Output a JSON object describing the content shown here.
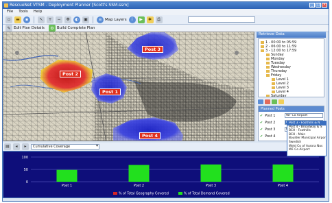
{
  "window": {
    "title": "RescueNet VTSM - Deployment Planner [Scott's SSM.ssm]"
  },
  "menu": [
    "File",
    "Tools",
    "Help"
  ],
  "toolbar": {
    "map_layers_label": "Map Layers",
    "search_value": ""
  },
  "toolbar2": {
    "edit_plan_label": "Edit Plan Details",
    "build_plan_label": "Build Complete Plan"
  },
  "map": {
    "posts": [
      {
        "label": "Post 1"
      },
      {
        "label": "Post 2"
      },
      {
        "label": "Post 3"
      },
      {
        "label": "Post 4"
      }
    ]
  },
  "retrieve": {
    "title": "Retrieve Data",
    "tree": [
      {
        "text": "1 - 00:00 to 05:59",
        "level": 0,
        "folder": true
      },
      {
        "text": "2 - 06:00 to 11:59",
        "level": 0,
        "folder": true
      },
      {
        "text": "3 - 12:00 to 17:59",
        "level": 0,
        "folder": true
      },
      {
        "text": "Sunday",
        "level": 1,
        "folder": true
      },
      {
        "text": "Monday",
        "level": 1,
        "folder": true
      },
      {
        "text": "Tuesday",
        "level": 1,
        "folder": true
      },
      {
        "text": "Wednesday",
        "level": 1,
        "folder": true
      },
      {
        "text": "Thursday",
        "level": 1,
        "folder": true
      },
      {
        "text": "Friday",
        "level": 1,
        "folder": true
      },
      {
        "text": "Level 1",
        "level": 2,
        "folder": true
      },
      {
        "text": "Level 2",
        "level": 2,
        "folder": true
      },
      {
        "text": "Level 3",
        "level": 2,
        "folder": true
      },
      {
        "text": "Level 4",
        "level": 2,
        "folder": true
      },
      {
        "text": "Saturday",
        "level": 1,
        "folder": true
      }
    ]
  },
  "planned": {
    "title": "Planned Posts",
    "rows": [
      {
        "post": "Post 1",
        "assignment": "WF Co Airport"
      },
      {
        "post": "Post 2",
        "assignment": "Post 2 - Foothills & N"
      },
      {
        "post": "Post 3",
        "assignment": "Post 3 - Foothills & N"
      },
      {
        "post": "Post 4",
        "assignment": ""
      }
    ],
    "dropdown": [
      "Post 3 - Foothills & N",
      "Post 4 - Broadway & S",
      "BCH - Foothills",
      "BCH - Main",
      "Boulder Municipal Airport",
      "Swedish",
      "Weld Co of Aurora Nos",
      "WF Co Airport"
    ]
  },
  "bottom": {
    "combo_value": "Cumulative Coverage"
  },
  "colors": {
    "geography": "#d62424",
    "demand": "#22e01e",
    "chart_bg": "#0e0e7a"
  },
  "chart_data": {
    "type": "bar",
    "categories": [
      "Post 1",
      "Post 2",
      "Post 3",
      "Post 4"
    ],
    "series": [
      {
        "name": "% of Total Geography Covered",
        "values": [
          0,
          0,
          0,
          0
        ]
      },
      {
        "name": "% of Total Demand Covered",
        "values": [
          48,
          68,
          70,
          70
        ]
      }
    ],
    "ylim": [
      0,
      100
    ],
    "yticks": [
      0,
      50,
      100
    ],
    "grid": true,
    "legend": "bottom"
  }
}
